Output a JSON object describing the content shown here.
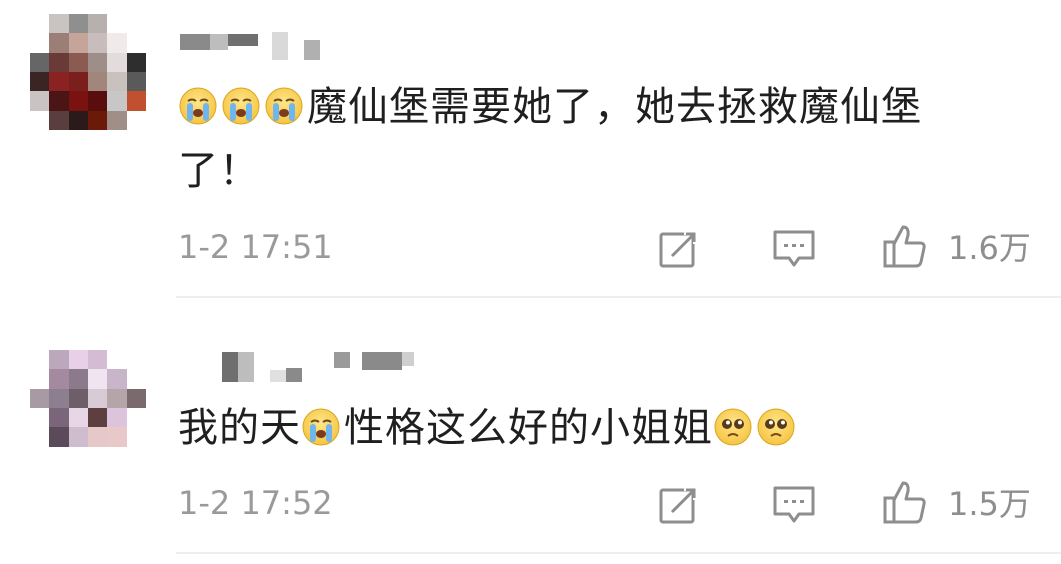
{
  "comments": [
    {
      "text_part1": "魔仙堡需要她了，她去拯救魔仙堡",
      "text_part2": "了！",
      "emojis": [
        "crying-emoji",
        "crying-emoji",
        "crying-emoji"
      ],
      "time": "1-2 17:51",
      "like_count": "1.6万",
      "avatar_colors": [
        [
          "#ffffff",
          "#c9c4c1",
          "#8f8f8f",
          "#b8b0ad",
          "#ffffff",
          "#ffffff"
        ],
        [
          "#ffffff",
          "#9b7f77",
          "#c5a49a",
          "#c8bcbc",
          "#f0eaea",
          "#ffffff"
        ],
        [
          "#666666",
          "#6a3b36",
          "#8b5a50",
          "#9e8e8a",
          "#e3dcdc",
          "#2e2e2e"
        ],
        [
          "#3a2424",
          "#8a2222",
          "#7a1e1e",
          "#a2857b",
          "#c9c1bd",
          "#5a5a5a"
        ],
        [
          "#c9c3c3",
          "#4b1515",
          "#7b1212",
          "#5a0d0d",
          "#c7c7c7",
          "#c05030"
        ],
        [
          "#ffffff",
          "#5a3d3d",
          "#2b1a1a",
          "#6b1a0a",
          "#9f8f87",
          "#ffffff"
        ]
      ]
    },
    {
      "text_part1": "我的天",
      "text_part2": "性格这么好的小姐姐",
      "emojis_mid": [
        "crying-emoji"
      ],
      "emojis_end": [
        "pleading-emoji",
        "pleading-emoji"
      ],
      "time": "1-2 17:52",
      "like_count": "1.5万",
      "avatar_colors": [
        [
          "#ffffff",
          "#bca8bc",
          "#e8d1e8",
          "#d4bcd4",
          "#ffffff",
          "#ffffff"
        ],
        [
          "#ffffff",
          "#a38aa0",
          "#8a7a8c",
          "#f0e4f0",
          "#c9b5c9",
          "#ffffff"
        ],
        [
          "#a89aa5",
          "#8e7f90",
          "#6e5e6a",
          "#d9cbd5",
          "#b6a5a8",
          "#7a6a6d"
        ],
        [
          "#ffffff",
          "#7a657a",
          "#e6d6e6",
          "#5e3f3f",
          "#ddc4dd",
          "#ffffff"
        ],
        [
          "#ffffff",
          "#5a4a5a",
          "#cfbccf",
          "#e7c8c8",
          "#e8c8c8",
          "#ffffff"
        ],
        [
          "#ffffff",
          "#ffffff",
          "#ffffff",
          "#ffffff",
          "#ffffff",
          "#ffffff"
        ]
      ]
    }
  ],
  "colors": {
    "text": "#1f1f1f",
    "meta": "#9a9a9a",
    "icon": "#8e8e8e",
    "divider": "#eeeeee"
  },
  "icons": {
    "share": "share-icon",
    "reply": "comment-icon",
    "like": "thumbs-up-icon"
  }
}
